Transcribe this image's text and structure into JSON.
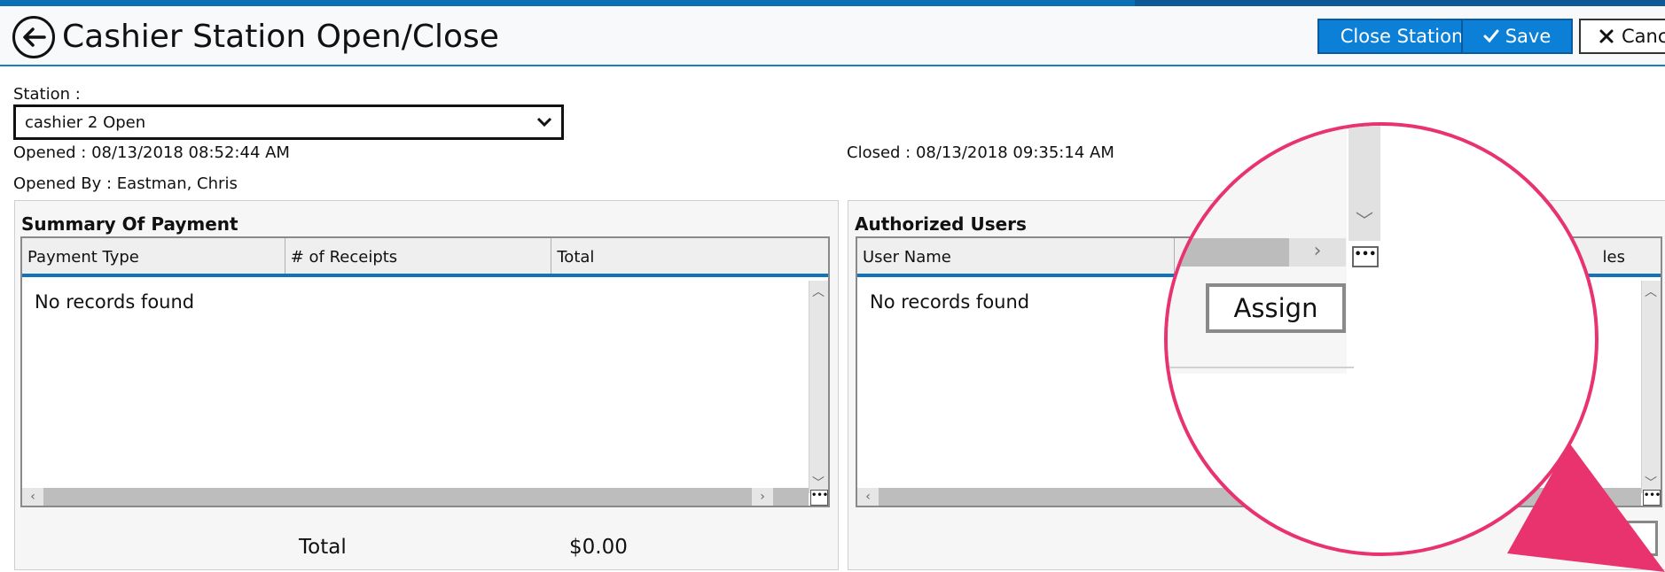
{
  "header": {
    "title": "Cashier Station Open/Close",
    "close_station_label": "Close Station",
    "save_label": "Save",
    "cancel_label": "Cancel"
  },
  "station": {
    "label": "Station :",
    "selected": "cashier 2 Open",
    "opened": "Opened : 08/13/2018 08:52:44 AM",
    "closed": "Closed : 08/13/2018 09:35:14 AM",
    "opened_by": "Opened By : Eastman, Chris"
  },
  "summary": {
    "title": "Summary Of Payment",
    "columns": [
      "Payment Type",
      "# of Receipts",
      "Total"
    ],
    "empty_text": "No records found",
    "total_label": "Total",
    "total_value": "$0.00"
  },
  "authorized": {
    "title": "Authorized Users",
    "columns": [
      "User Name",
      "les"
    ],
    "empty_text": "No records found",
    "assign_label": "Assign"
  },
  "magnifier": {
    "assign_label": "Assign"
  },
  "colors": {
    "primary": "#0c7fd6",
    "header_rule": "#1a7cc2",
    "callout": "#e8336e"
  },
  "icons": {
    "back": "arrow-left-circle-icon",
    "save": "check-icon",
    "cancel": "x-icon",
    "dropdown": "chevron-down-icon"
  }
}
